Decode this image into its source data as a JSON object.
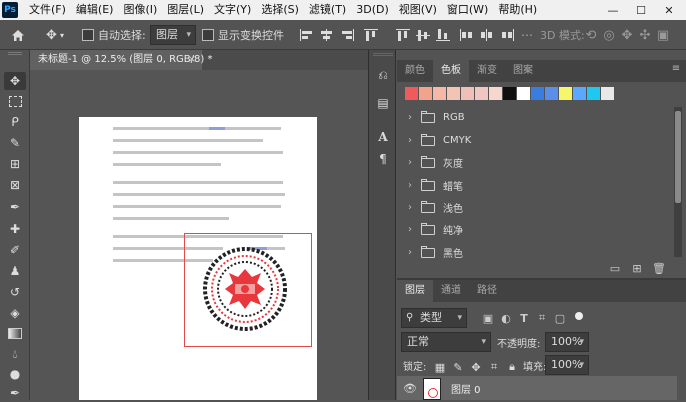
{
  "app": {
    "logo": "Ps"
  },
  "menu": [
    "文件(F)",
    "编辑(E)",
    "图像(I)",
    "图层(L)",
    "文字(Y)",
    "选择(S)",
    "滤镜(T)",
    "3D(D)",
    "视图(V)",
    "窗口(W)",
    "帮助(H)"
  ],
  "window_controls": {
    "minimize": "—",
    "maximize": "☐",
    "close": "✕"
  },
  "options": {
    "auto_select_label": "自动选择:",
    "auto_select_target": "图层",
    "show_transform_label": "显示变换控件",
    "mode_3d_label": "3D 模式:"
  },
  "document": {
    "tab_title": "未标题-1 @ 12.5% (图层 0, RGB/8) *",
    "tab_close": "×"
  },
  "swatches_panel": {
    "tabs": [
      "颜色",
      "色板",
      "渐变",
      "图案"
    ],
    "active_tab": "色板",
    "recent_colors": [
      "#f05a5a",
      "#f2a38c",
      "#f5b8a8",
      "#f3c4b5",
      "#f0c0b8",
      "#f2c6c0",
      "#f7d6d0",
      "#101010",
      "#ffffff",
      "#3a7de0",
      "#5a8ee8",
      "#f6f66a",
      "#5aa8ff",
      "#1ec8f0",
      "#e8e8e8"
    ],
    "groups": [
      "RGB",
      "CMYK",
      "灰度",
      "蜡笔",
      "浅色",
      "纯净",
      "黑色"
    ]
  },
  "layers_panel": {
    "tabs": [
      "图层",
      "通道",
      "路径"
    ],
    "active_tab": "图层",
    "filter_label": "类型",
    "blend_mode": "正常",
    "opacity_label": "不透明度:",
    "opacity_value": "100%",
    "lock_label": "锁定:",
    "fill_label": "填充:",
    "fill_value": "100%",
    "layers": [
      {
        "name": "图层 0",
        "visible": true
      }
    ]
  },
  "colors": {
    "ui_dark": "#535353",
    "panel_tab_bg": "#424242",
    "selection_border": "#e04a4a",
    "stamp_red": "#e8383d"
  }
}
